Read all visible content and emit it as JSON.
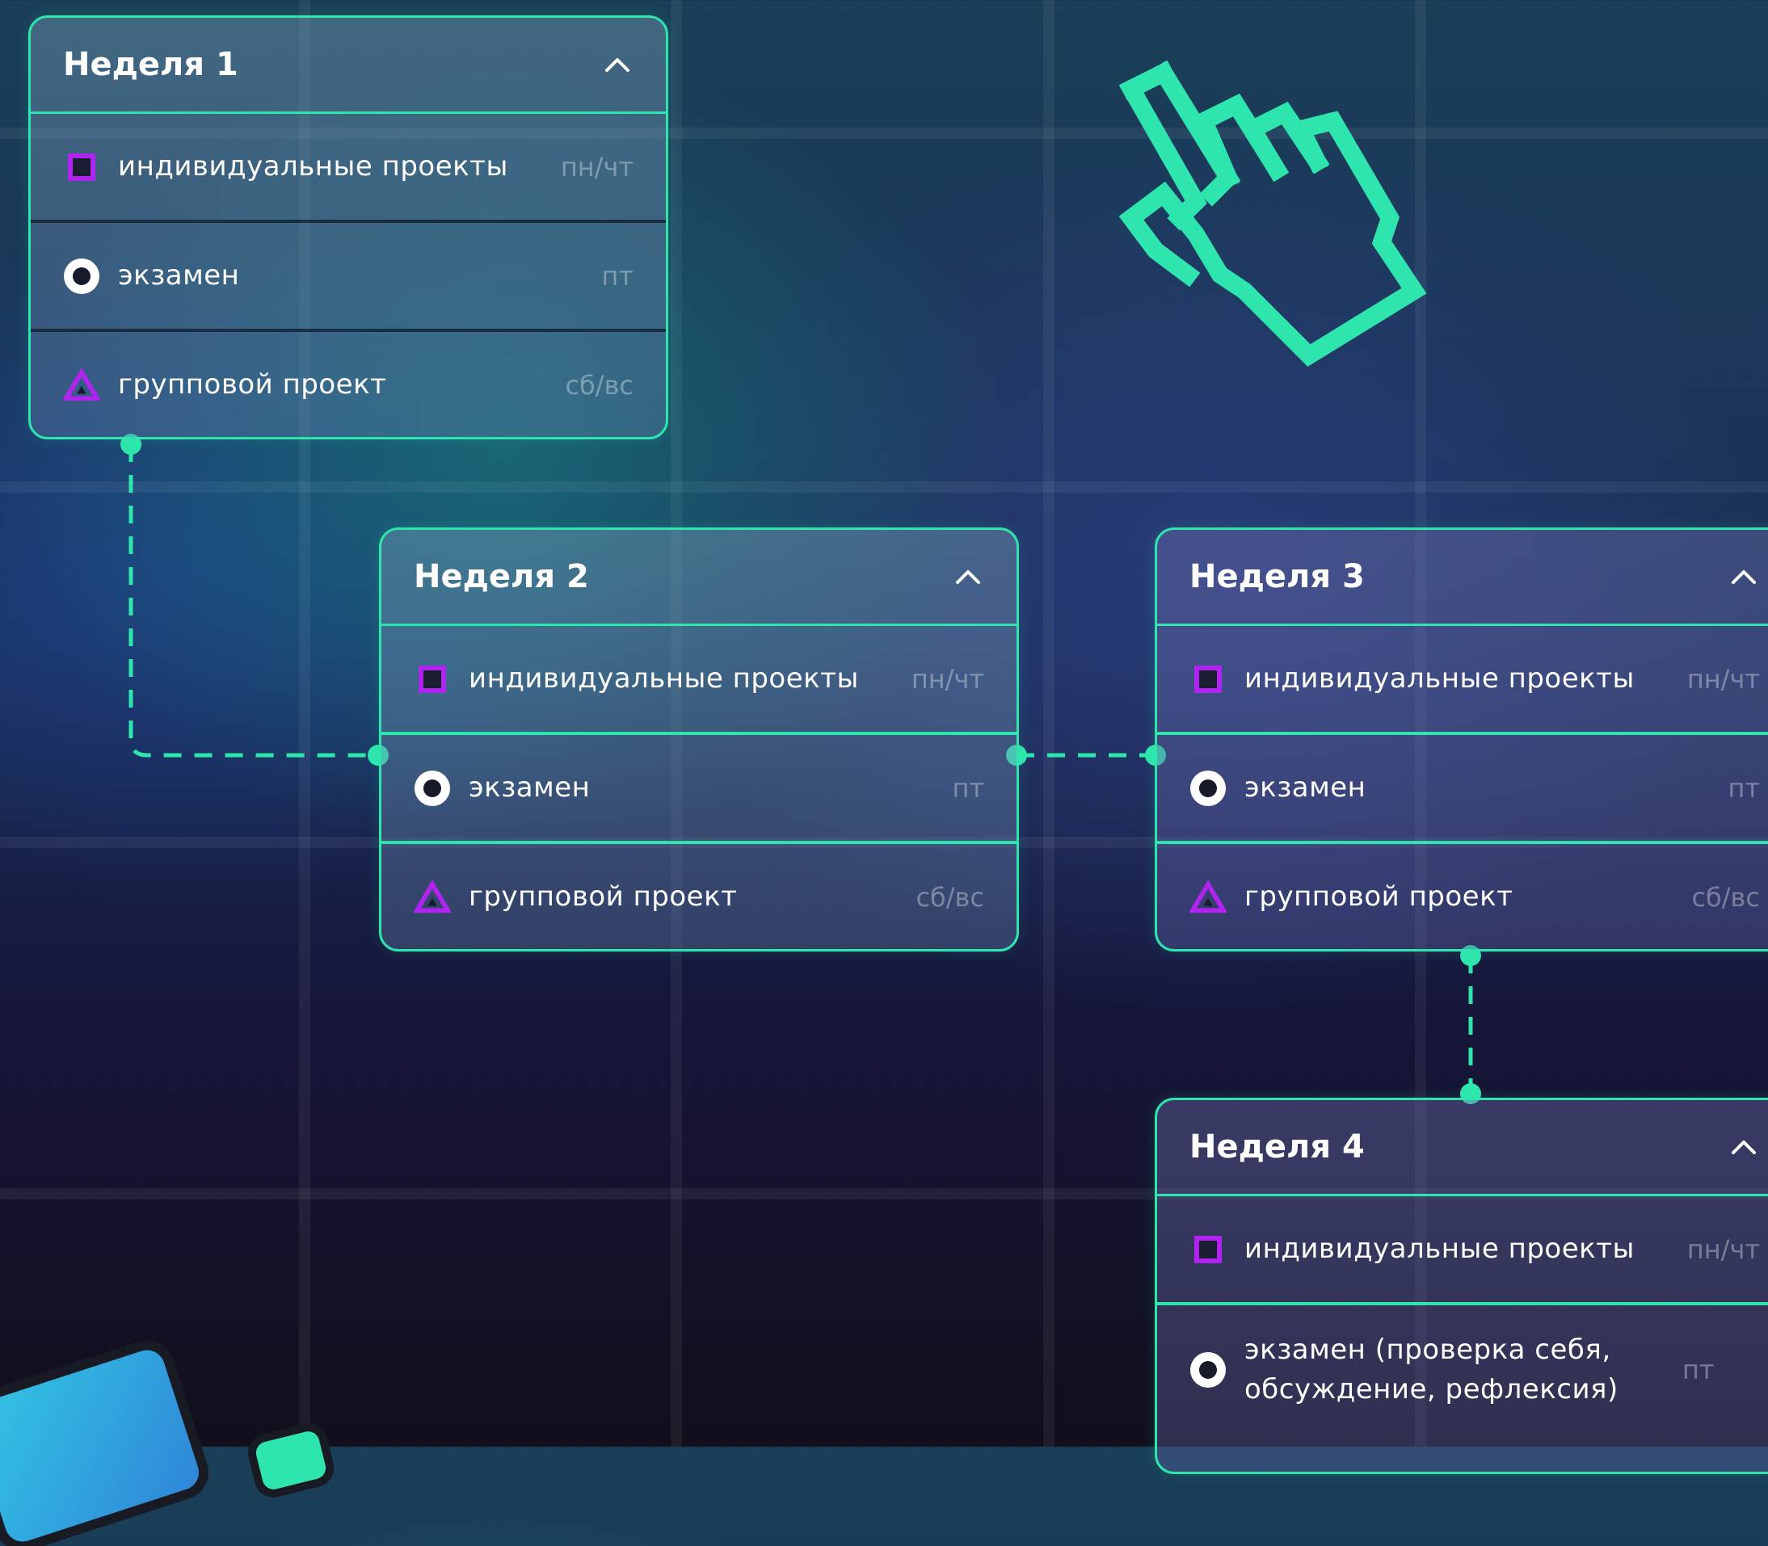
{
  "accent_color": "#2ee6ad",
  "icon_color": "#b024f0",
  "weeks": [
    {
      "title": "Неделя 1",
      "items": [
        {
          "icon": "square-icon",
          "label": "индивидуальные проекты",
          "days": "пн/чт"
        },
        {
          "icon": "circle-icon",
          "label": "экзамен",
          "days": "пт"
        },
        {
          "icon": "triangle-icon",
          "label": "групповой проект",
          "days": "сб/вс"
        }
      ]
    },
    {
      "title": "Неделя 2",
      "items": [
        {
          "icon": "square-icon",
          "label": "индивидуальные проекты",
          "days": "пн/чт"
        },
        {
          "icon": "circle-icon",
          "label": "экзамен",
          "days": "пт"
        },
        {
          "icon": "triangle-icon",
          "label": "групповой проект",
          "days": "сб/вс"
        }
      ]
    },
    {
      "title": "Неделя 3",
      "items": [
        {
          "icon": "square-icon",
          "label": "индивидуальные проекты",
          "days": "пн/чт"
        },
        {
          "icon": "circle-icon",
          "label": "экзамен",
          "days": "пт"
        },
        {
          "icon": "triangle-icon",
          "label": "групповой проект",
          "days": "сб/вс"
        }
      ]
    },
    {
      "title": "Неделя 4",
      "items": [
        {
          "icon": "square-icon",
          "label": "индивидуальные проекты",
          "days": "пн/чт"
        },
        {
          "icon": "circle-icon",
          "label": "экзамен (проверка себя, обсуждение, рефлексия)",
          "days": "пт"
        }
      ]
    }
  ]
}
